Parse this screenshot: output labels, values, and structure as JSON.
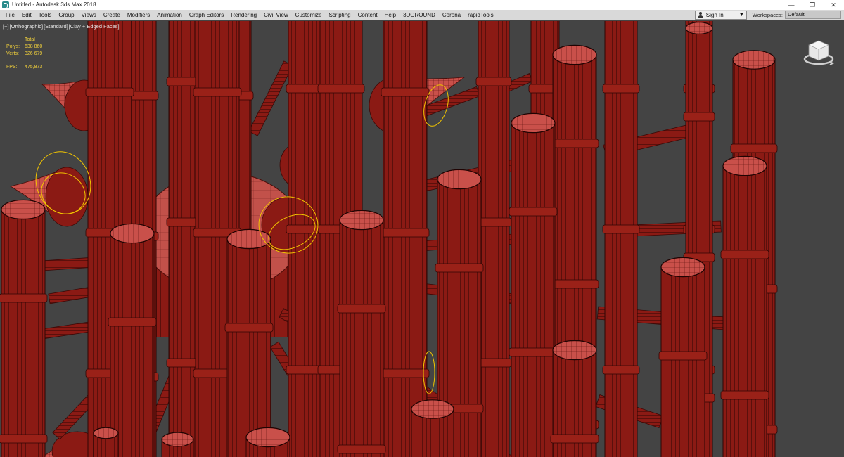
{
  "window": {
    "title": "Untitled - Autodesk 3ds Max 2018",
    "minimize": "—",
    "maximize": "❐",
    "close": "✕"
  },
  "menu": [
    "File",
    "Edit",
    "Tools",
    "Group",
    "Views",
    "Create",
    "Modifiers",
    "Animation",
    "Graph Editors",
    "Rendering",
    "Civil View",
    "Customize",
    "Scripting",
    "Content",
    "Help",
    "3DGROUND",
    "Corona",
    "rapidTools"
  ],
  "account": {
    "sign_in": "Sign In"
  },
  "workspaces": {
    "label": "Workspaces:",
    "value": "Default"
  },
  "viewport": {
    "labels": [
      "[+]",
      "[Orthographic]",
      "[Standard]",
      "[Clay + Edged Faces]"
    ],
    "stats": {
      "header": "Total",
      "polys_label": "Polys:",
      "polys_value": "638 860",
      "verts_label": "Verts:",
      "verts_value": "326 679",
      "fps_label": "FPS:",
      "fps_value": "475,873"
    },
    "colors": {
      "background": "#444444",
      "clay": "#8b1a14",
      "highlight": "#c94a40",
      "selection": "#f2c500"
    }
  }
}
